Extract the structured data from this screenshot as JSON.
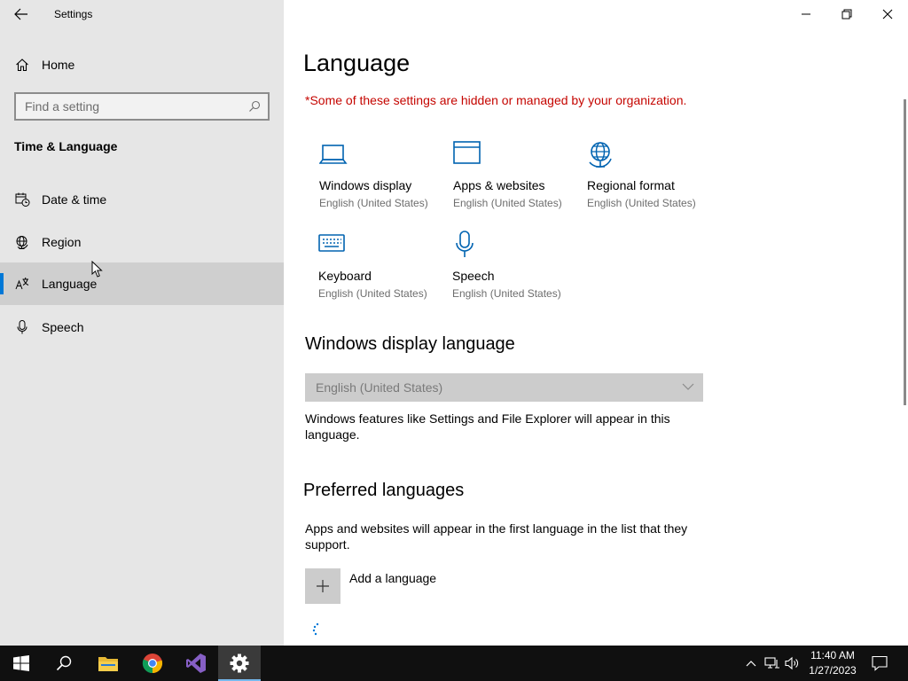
{
  "window": {
    "title": "Settings",
    "controls": [
      "minimize-icon",
      "restore-icon",
      "close-icon"
    ]
  },
  "sidebar": {
    "home_label": "Home",
    "search_placeholder": "Find a setting",
    "section_title": "Time & Language",
    "items": [
      {
        "label": "Date & time",
        "icon": "date-time-icon",
        "selected": false
      },
      {
        "label": "Region",
        "icon": "globe-icon",
        "selected": false
      },
      {
        "label": "Language",
        "icon": "language-icon",
        "selected": true
      },
      {
        "label": "Speech",
        "icon": "microphone-icon",
        "selected": false
      }
    ]
  },
  "main": {
    "title": "Language",
    "warning": "*Some of these settings are hidden or managed by your organization.",
    "tiles": [
      {
        "title": "Windows display",
        "subtitle": "English (United States)",
        "icon": "laptop-icon"
      },
      {
        "title": "Apps & websites",
        "subtitle": "English (United States)",
        "icon": "browser-window-icon"
      },
      {
        "title": "Regional format",
        "subtitle": "English (United States)",
        "icon": "regional-format-icon"
      },
      {
        "title": "Keyboard",
        "subtitle": "English (United States)",
        "icon": "keyboard-icon"
      },
      {
        "title": "Speech",
        "subtitle": "English (United States)",
        "icon": "microphone-icon"
      }
    ],
    "display_language": {
      "heading": "Windows display language",
      "selected": "English (United States)",
      "description": "Windows features like Settings and File Explorer will appear in this language."
    },
    "preferred": {
      "heading": "Preferred languages",
      "description": "Apps and websites will appear in the first language in the list that they support.",
      "add_label": "Add a language"
    }
  },
  "taskbar": {
    "apps": [
      "start-icon",
      "search-icon",
      "file-explorer-icon",
      "chrome-icon",
      "visual-studio-icon",
      "settings-icon"
    ],
    "active_app": "settings-icon",
    "time": "11:40 AM",
    "date": "1/27/2023"
  },
  "colors": {
    "accent": "#0078d7",
    "warning": "#c50500",
    "sidebar_bg": "#e6e6e6",
    "taskbar_bg": "#101010"
  }
}
